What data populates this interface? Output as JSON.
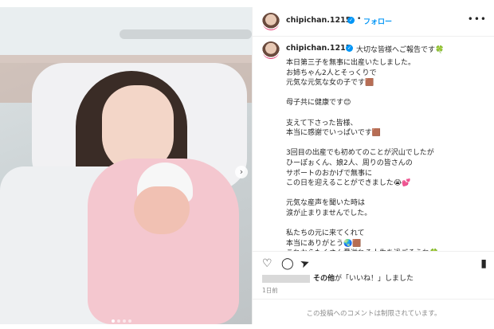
{
  "post": {
    "username": "chipichan.1215",
    "verified_badge": "✓",
    "separator": "•",
    "follow_label": "フォロー",
    "more_label": "•••",
    "caption_first": "大切な皆様へご報告です🍀",
    "caption_lines": [
      "本日第三子を無事に出産いたしました。",
      "お姉ちゃん2人とそっくりで",
      "元気な元気な女の子です🟫",
      "",
      "母子共に健康です😊",
      "",
      "支えて下さった皆様、",
      "本当に感謝でいっぱいです🟫",
      "",
      "3回目の出産でも初めてのことが沢山でしたが",
      "ひーぽぉくん、娘2人、周りの皆さんの",
      "サポートのおかげで無事に",
      "この日を迎えることができました😭💕",
      "",
      "元気な産声を聞いた時は",
      "涙が止まりませんでした。",
      "",
      "私たちの元に来てくれて",
      "本当にありがとう🌏🟫",
      "これからたくさん愛溢れる人生を過ごそうね🍀"
    ],
    "likes_text": "その他",
    "likes_suffix": "が「いいね！」しました",
    "date": "1日前",
    "comments_disabled": "この投稿へのコメントは制限されています。"
  },
  "icons": {
    "heart": "♡",
    "comment": "◯",
    "share": "➤",
    "bookmark": "▮",
    "next": "›"
  },
  "colors": {
    "link": "#0095f6",
    "muted": "#8e8e8e"
  }
}
